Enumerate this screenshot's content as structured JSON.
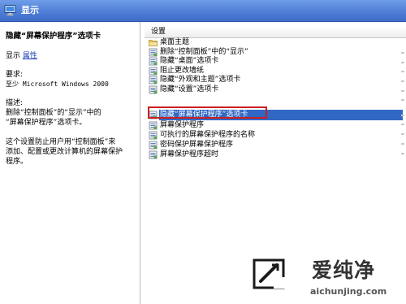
{
  "header": {
    "title": "显示",
    "icon": "display-icon",
    "color": "#4f7fd7"
  },
  "description": {
    "setting_title": "隐藏“屏幕保护程序”选项卡",
    "display_label": "显示",
    "display_link": "属性",
    "requirements_label": "要求:",
    "requirements_value": "至少 Microsoft Windows 2000",
    "desc_label": "描述:",
    "desc_line1": "删除“控制面板”的“显示”中的",
    "desc_line2": "“屏幕保护程序”选项卡。",
    "detail_line1": "这个设置防止用户用“控制面板”来",
    "detail_line2": "添加、配置或更改计算机的屏幕保护",
    "detail_line3": "程序。"
  },
  "settings_list": {
    "column_header": "设置",
    "items": [
      {
        "label": "桌面主题",
        "icon": "folder-icon"
      },
      {
        "label": "删除“控制面板”中的“显示”",
        "icon": "policy-setting-icon"
      },
      {
        "label": "隐藏“桌面”选项卡",
        "icon": "policy-setting-icon"
      },
      {
        "label": "阻止更改墙纸",
        "icon": "policy-setting-icon"
      },
      {
        "label": "隐藏“外观和主题”选项卡",
        "icon": "policy-setting-icon"
      },
      {
        "label": "隐藏“设置”选项卡",
        "icon": "policy-setting-icon"
      },
      {
        "label": "隐藏“屏幕保护程序”选项卡",
        "icon": "policy-setting-icon",
        "selected": true
      },
      {
        "label": "屏幕保护程序",
        "icon": "policy-setting-icon"
      },
      {
        "label": "可执行的屏幕保护程序的名称",
        "icon": "policy-setting-icon"
      },
      {
        "label": "密码保护屏幕保护程序",
        "icon": "policy-setting-icon"
      },
      {
        "label": "屏幕保护程序超时",
        "icon": "policy-setting-icon"
      }
    ],
    "selection_color": "#3168c5",
    "highlight_box_color": "#cc1f1f"
  },
  "watermark": {
    "name": "爱纯净",
    "url": "aichunjing.com",
    "icon": "aichunjing-logo-icon"
  }
}
